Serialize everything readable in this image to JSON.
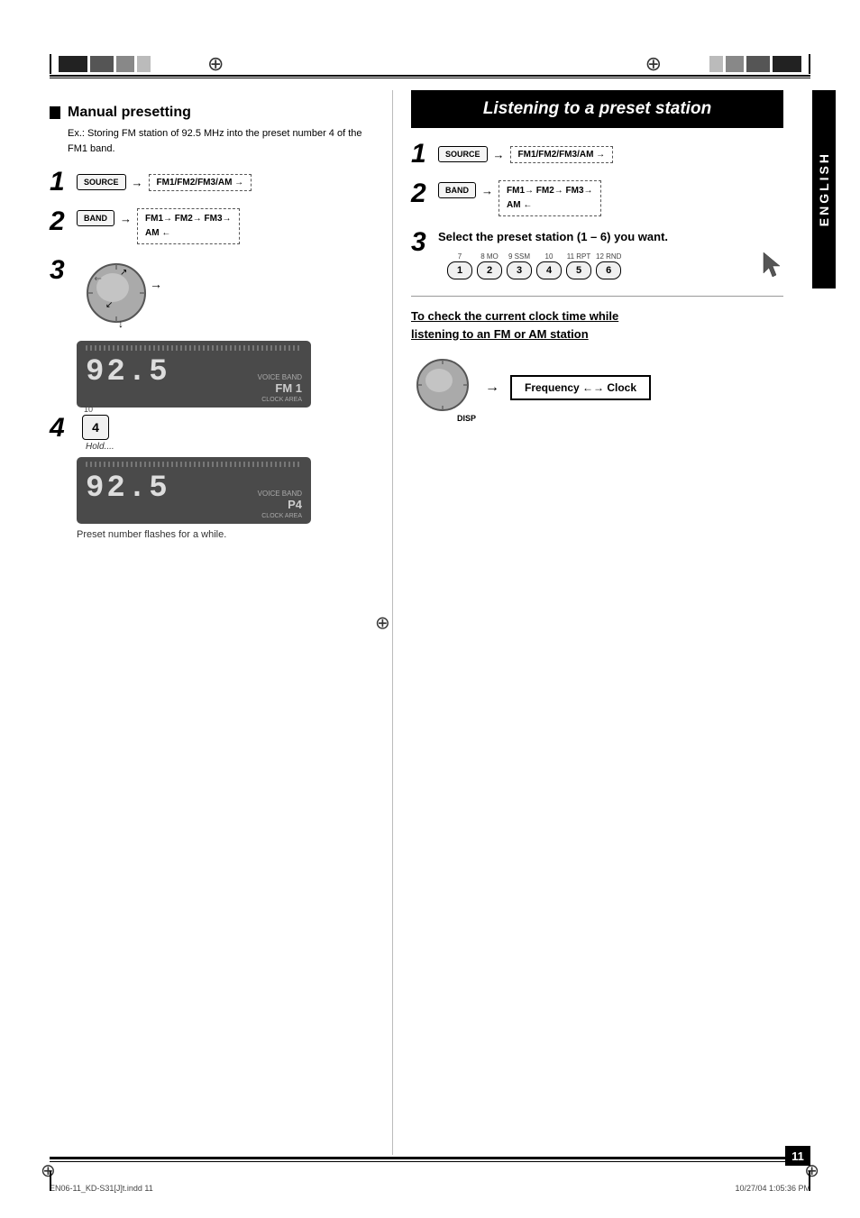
{
  "page": {
    "number": "11",
    "footer_left": "EN06-11_KD-S31[J]t.indd  11",
    "footer_right": "10/27/04  1:05:36 PM"
  },
  "left_section": {
    "title": "Manual presetting",
    "subtitle": "Ex.: Storing FM station of 92.5 MHz into the\npreset number 4 of the FM1 band.",
    "steps": [
      {
        "number": "1",
        "label": "SOURCE button",
        "sequence": "FM1/FM2/FM3/AM →"
      },
      {
        "number": "2",
        "label": "BAND button",
        "sequence": "FM1→ FM2→ FM3→\nAM ←"
      },
      {
        "number": "3",
        "description": "Tune knob"
      },
      {
        "number": "4",
        "btn_label": "4",
        "btn_num": "10",
        "hold_text": "Hold....",
        "caption": "Preset number flashes for a while."
      }
    ],
    "display1": {
      "freq": "92.5",
      "band": "FM 1"
    },
    "display2": {
      "freq": "92.5",
      "preset": "P4"
    }
  },
  "right_section": {
    "title": "Listening to a preset station",
    "steps": [
      {
        "number": "1",
        "label": "SOURCE button",
        "sequence": "FM1/FM2/FM3/AM →"
      },
      {
        "number": "2",
        "label": "BAND button",
        "sequence": "FM1→ FM2→ FM3→\nAM ←"
      },
      {
        "number": "3",
        "text": "Select the preset station (1 – 6) you want.",
        "presets": [
          {
            "num": "1",
            "label": "7"
          },
          {
            "num": "2",
            "label": "8 MO"
          },
          {
            "num": "3",
            "label": "9 SSM"
          },
          {
            "num": "4",
            "label": "10"
          },
          {
            "num": "5",
            "label": "11 RPT"
          },
          {
            "num": "6",
            "label": "12 RND"
          }
        ]
      }
    ],
    "disp_section": {
      "title": "To check the current clock time while\nlistening to an FM or AM station",
      "button": "DISP",
      "sequence": "Frequency ←→ Clock"
    },
    "sidebar": "ENGLISH"
  }
}
